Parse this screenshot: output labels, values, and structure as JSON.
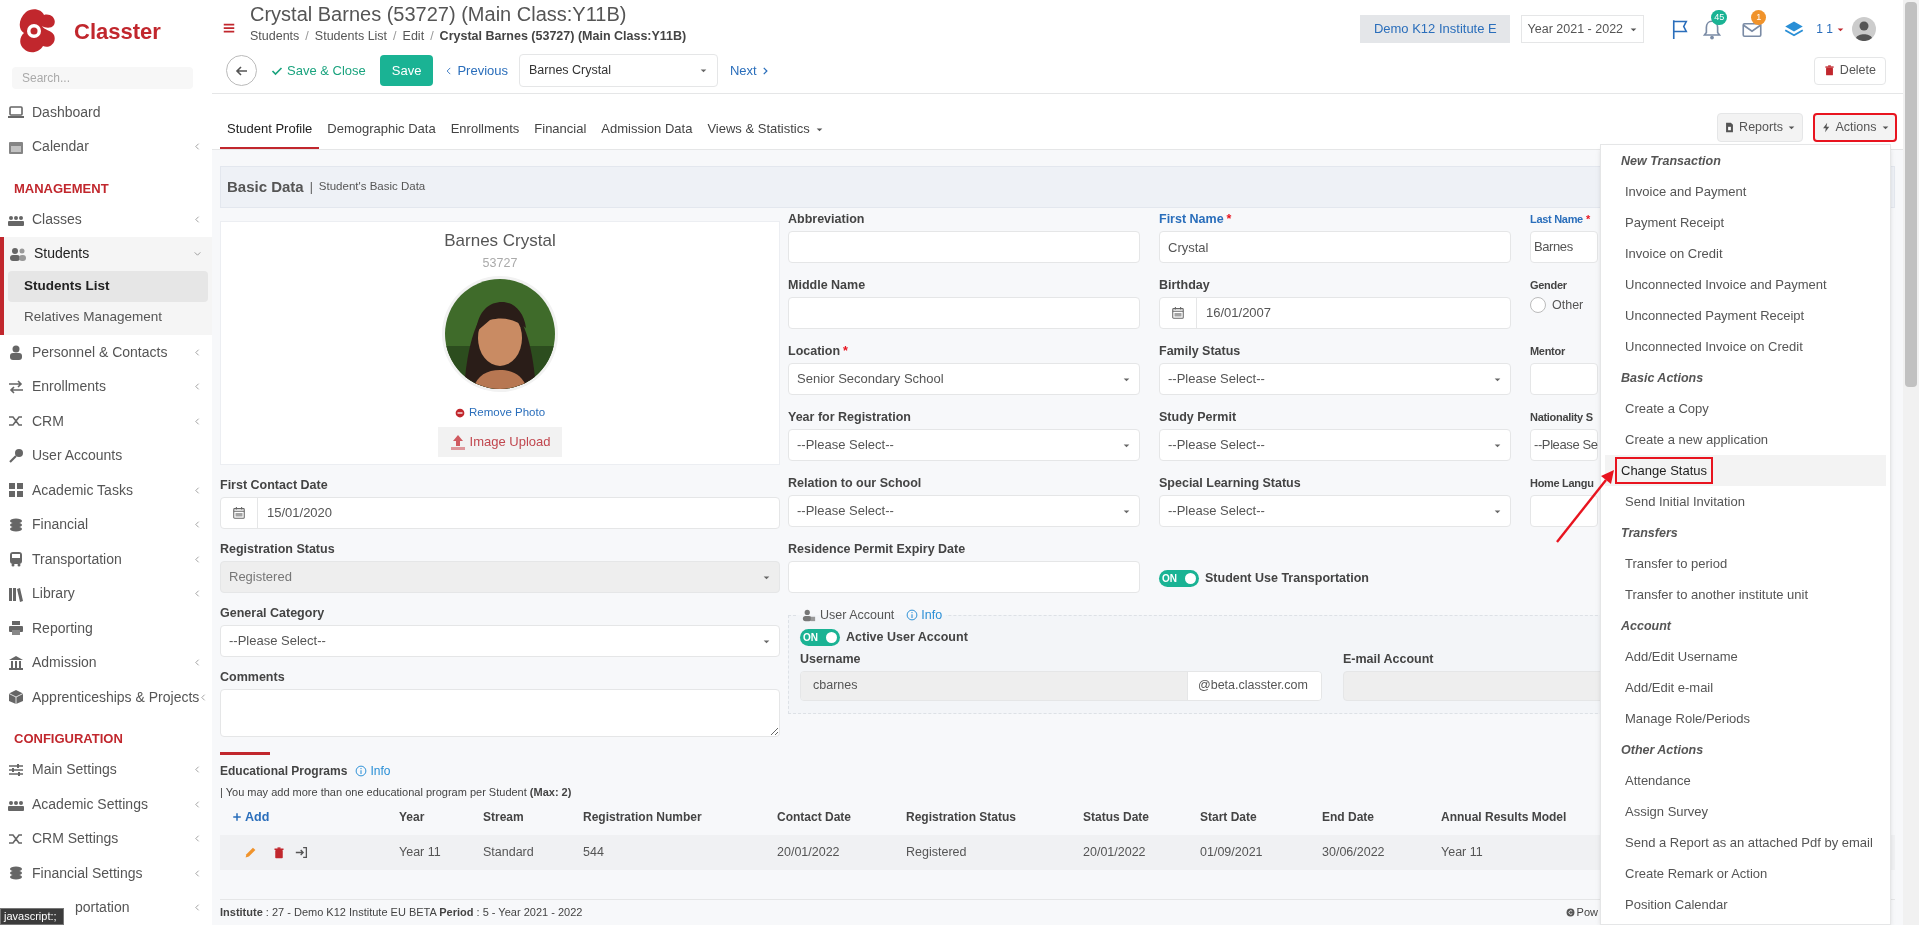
{
  "sidebar": {
    "brand": "Classter",
    "search_placeholder": "Search...",
    "items": [
      {
        "kind": "item",
        "label": "Dashboard",
        "expandable": false,
        "expanded": false
      },
      {
        "kind": "item",
        "label": "Calendar",
        "expandable": true,
        "expanded": false
      },
      {
        "kind": "heading",
        "label": "MANAGEMENT"
      },
      {
        "kind": "item",
        "label": "Classes",
        "expandable": true,
        "expanded": false
      },
      {
        "kind": "item",
        "label": "Students",
        "expandable": true,
        "expanded": true,
        "children": [
          {
            "label": "Students List",
            "selected": true
          },
          {
            "label": "Relatives Management",
            "selected": false
          }
        ]
      },
      {
        "kind": "item",
        "label": "Personnel & Contacts",
        "expandable": true,
        "expanded": false
      },
      {
        "kind": "item",
        "label": "Enrollments",
        "expandable": true,
        "expanded": false
      },
      {
        "kind": "item",
        "label": "CRM",
        "expandable": true,
        "expanded": false
      },
      {
        "kind": "item",
        "label": "User Accounts",
        "expandable": false,
        "expanded": false
      },
      {
        "kind": "item",
        "label": "Academic Tasks",
        "expandable": true,
        "expanded": false
      },
      {
        "kind": "item",
        "label": "Financial",
        "expandable": true,
        "expanded": false
      },
      {
        "kind": "item",
        "label": "Transportation",
        "expandable": true,
        "expanded": false
      },
      {
        "kind": "item",
        "label": "Library",
        "expandable": true,
        "expanded": false
      },
      {
        "kind": "item",
        "label": "Reporting",
        "expandable": false,
        "expanded": false
      },
      {
        "kind": "item",
        "label": "Admission",
        "expandable": true,
        "expanded": false
      },
      {
        "kind": "item",
        "label": "Apprenticeships & Projects",
        "expandable": true,
        "expanded": false
      },
      {
        "kind": "heading",
        "label": "CONFIGURATION"
      },
      {
        "kind": "item",
        "label": "Main Settings",
        "expandable": true,
        "expanded": false
      },
      {
        "kind": "item",
        "label": "Academic Settings",
        "expandable": true,
        "expanded": false
      },
      {
        "kind": "item",
        "label": "CRM Settings",
        "expandable": true,
        "expanded": false
      },
      {
        "kind": "item",
        "label": "Financial Settings",
        "expandable": true,
        "expanded": false
      },
      {
        "kind": "partial",
        "label": "portation",
        "expandable": true,
        "expanded": false
      }
    ]
  },
  "status_tooltip": "javascript:;",
  "header": {
    "title": "Crystal Barnes (53727) (Main Class:Y11B)",
    "separator": "/",
    "breadcrumb": [
      {
        "label": "Students",
        "current": false
      },
      {
        "label": "Students List",
        "current": false
      },
      {
        "label": "Edit",
        "current": false
      },
      {
        "label": "Crystal Barnes (53727) (Main Class:Y11B)",
        "current": true
      }
    ],
    "institute": "Demo K12 Institute E",
    "year": "Year 2021 - 2022",
    "notifications": "45",
    "messages": "1",
    "user": "1 1"
  },
  "toolbar": {
    "save_close": "Save & Close",
    "save": "Save",
    "previous": "Previous",
    "student": "Barnes Crystal",
    "next": "Next",
    "delete": "Delete"
  },
  "tabs": [
    {
      "label": "Student Profile",
      "selected": true,
      "dropdown": false
    },
    {
      "label": "Demographic Data",
      "selected": false,
      "dropdown": false
    },
    {
      "label": "Enrollments",
      "selected": false,
      "dropdown": false
    },
    {
      "label": "Financial",
      "selected": false,
      "dropdown": false
    },
    {
      "label": "Admission Data",
      "selected": false,
      "dropdown": false
    },
    {
      "label": "Views & Statistics",
      "selected": false,
      "dropdown": true
    }
  ],
  "tab_actions": {
    "reports": "Reports",
    "actions": "Actions",
    "actions_highlighted": true
  },
  "actions_menu": [
    {
      "kind": "heading",
      "label": "New Transaction"
    },
    {
      "kind": "item",
      "label": "Invoice and Payment",
      "highlighted": false
    },
    {
      "kind": "item",
      "label": "Payment Receipt",
      "highlighted": false
    },
    {
      "kind": "item",
      "label": "Invoice on Credit",
      "highlighted": false
    },
    {
      "kind": "item",
      "label": "Unconnected Invoice and Payment",
      "highlighted": false
    },
    {
      "kind": "item",
      "label": "Unconnected Payment Receipt",
      "highlighted": false
    },
    {
      "kind": "item",
      "label": "Unconnected Invoice on Credit",
      "highlighted": false
    },
    {
      "kind": "heading",
      "label": "Basic Actions"
    },
    {
      "kind": "item",
      "label": "Create a Copy",
      "highlighted": false
    },
    {
      "kind": "item",
      "label": "Create a new application",
      "highlighted": false
    },
    {
      "kind": "item",
      "label": "Change Status",
      "highlighted": true
    },
    {
      "kind": "item",
      "label": "Send Initial Invitation",
      "highlighted": false
    },
    {
      "kind": "heading",
      "label": "Transfers"
    },
    {
      "kind": "item",
      "label": "Transfer to period",
      "highlighted": false
    },
    {
      "kind": "item",
      "label": "Transfer to another institute unit",
      "highlighted": false
    },
    {
      "kind": "heading",
      "label": "Account"
    },
    {
      "kind": "item",
      "label": "Add/Edit Username",
      "highlighted": false
    },
    {
      "kind": "item",
      "label": "Add/Edit e-mail",
      "highlighted": false
    },
    {
      "kind": "item",
      "label": "Manage Role/Periods",
      "highlighted": false
    },
    {
      "kind": "heading",
      "label": "Other Actions"
    },
    {
      "kind": "item",
      "label": "Attendance",
      "highlighted": false
    },
    {
      "kind": "item",
      "label": "Assign Survey",
      "highlighted": false
    },
    {
      "kind": "item",
      "label": "Send a Report as an attached Pdf by email",
      "highlighted": false
    },
    {
      "kind": "item",
      "label": "Create Remark or Action",
      "highlighted": false
    },
    {
      "kind": "item",
      "label": "Position Calendar",
      "highlighted": false
    }
  ],
  "section": {
    "title": "Basic Data",
    "separator": "|",
    "subtitle": "Student's Basic Data"
  },
  "required_mark": "*",
  "profile": {
    "name": "Barnes Crystal",
    "id": "53727",
    "remove_photo": "Remove Photo",
    "upload": "Image Upload"
  },
  "left_fields": [
    {
      "kind": "date",
      "label": "First Contact Date",
      "value": "15/01/2020"
    },
    {
      "kind": "select",
      "label": "Registration Status",
      "value": "Registered",
      "disabled": true
    },
    {
      "kind": "select",
      "label": "General Category",
      "value": "--Please Select--",
      "disabled": false
    },
    {
      "kind": "textarea",
      "label": "Comments"
    }
  ],
  "grid": [
    [
      {
        "kind": "text",
        "label": "Abbreviation"
      },
      {
        "kind": "text",
        "label": "First Name",
        "value": "Crystal",
        "required": true,
        "accent": true
      },
      {
        "kind": "text",
        "label": "Last Name",
        "value": "Barnes",
        "required": true,
        "accent": true
      }
    ],
    [
      {
        "kind": "text",
        "label": "Middle Name"
      },
      {
        "kind": "date",
        "label": "Birthday",
        "value": "16/01/2007"
      },
      {
        "kind": "radio",
        "label": "Gender",
        "option": "Other",
        "checked": false
      }
    ],
    [
      {
        "kind": "select",
        "label": "Location",
        "value": "Senior Secondary School",
        "required": true
      },
      {
        "kind": "select",
        "label": "Family Status",
        "value": "--Please Select--"
      },
      {
        "kind": "text",
        "label": "Mentor"
      }
    ],
    [
      {
        "kind": "select",
        "label": "Year for Registration",
        "value": "--Please Select--"
      },
      {
        "kind": "select",
        "label": "Study Permit",
        "value": "--Please Select--"
      },
      {
        "kind": "text",
        "label": "Nationality S",
        "value": "--Please Se"
      }
    ],
    [
      {
        "kind": "select",
        "label": "Relation to our School",
        "value": "--Please Select--"
      },
      {
        "kind": "select",
        "label": "Special Learning Status",
        "value": "--Please Select--"
      },
      {
        "kind": "text",
        "label": "Home Langu"
      }
    ],
    [
      {
        "kind": "text",
        "label": "Residence Permit Expiry Date"
      },
      {
        "kind": "toggle",
        "label": "Student Use Transportation",
        "on": true,
        "on_text": "ON"
      }
    ]
  ],
  "user_account": {
    "title": "User Account",
    "info": "Info",
    "active_label": "Active User Account",
    "active": true,
    "on_text": "ON",
    "username_label": "Username",
    "username": "cbarnes",
    "domain": "@beta.classter.com",
    "email_label": "E-mail Account"
  },
  "education": {
    "title": "Educational Programs",
    "info": "Info",
    "note": "| You may add more than one educational program per Student **(Max: 2)**",
    "add": "Add",
    "columns": [
      "Year",
      "Stream",
      "Registration Number",
      "Contact Date",
      "Registration Status",
      "Status Date",
      "Start Date",
      "End Date",
      "Annual Results Model"
    ],
    "rows": [
      [
        "Year 11",
        "Standard",
        "544",
        "20/01/2022",
        "Registered",
        "20/01/2022",
        "01/09/2021",
        "30/06/2022",
        "Year 11"
      ]
    ]
  },
  "footer": {
    "text": "**Institute** : 27 - Demo K12 Institute EU BETA **Period** : 5 - Year 2021 - 2022",
    "powered": "Pow"
  }
}
